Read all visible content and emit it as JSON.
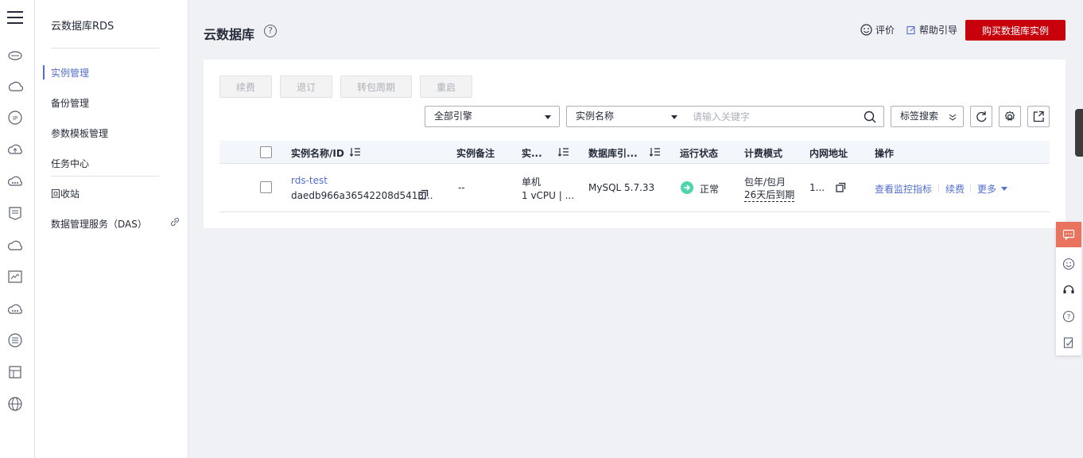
{
  "sidebar": {
    "title": "云数据库RDS",
    "items": [
      {
        "label": "实例管理",
        "active": true
      },
      {
        "label": "备份管理"
      },
      {
        "label": "参数模板管理"
      },
      {
        "label": "任务中心"
      },
      {
        "label": "回收站"
      },
      {
        "label": "数据管理服务（DAS）"
      }
    ]
  },
  "header": {
    "title": "云数据库",
    "help_glyph": "?",
    "eval_label": "评价",
    "help_label": "帮助引导",
    "buy_label": "购买数据库实例"
  },
  "toolbar": {
    "renew": "续费",
    "unsubscribe": "退订",
    "to_monthly": "转包周期",
    "restart": "重启"
  },
  "filters": {
    "engine_select": "全部引擎",
    "field_select": "实例名称",
    "search_placeholder": "请输入关键字",
    "tag_search": "标签搜索"
  },
  "table": {
    "columns": {
      "name": "实例名称/ID",
      "remark": "实例备注",
      "type": "实...",
      "engine": "数据库引...",
      "status": "运行状态",
      "billing": "计费模式",
      "ip": "内网地址",
      "actions": "操作"
    },
    "rows": [
      {
        "name": "rds-test",
        "id": "daedb966a36542208d5413...",
        "remark": "--",
        "type_line1": "单机",
        "type_line2": "1 vCPU | ...",
        "engine": "MySQL 5.7.33",
        "status": "正常",
        "billing_line1": "包年/包月",
        "billing_line2": "26天后到期",
        "ip": "1...",
        "action_monitor": "查看监控指标",
        "action_renew": "续费",
        "action_more": "更多"
      }
    ]
  },
  "colors": {
    "brand_red": "#c7000b",
    "link_blue": "#526ecc",
    "status_green": "#50d4ab",
    "float_accent": "#e8735f"
  }
}
